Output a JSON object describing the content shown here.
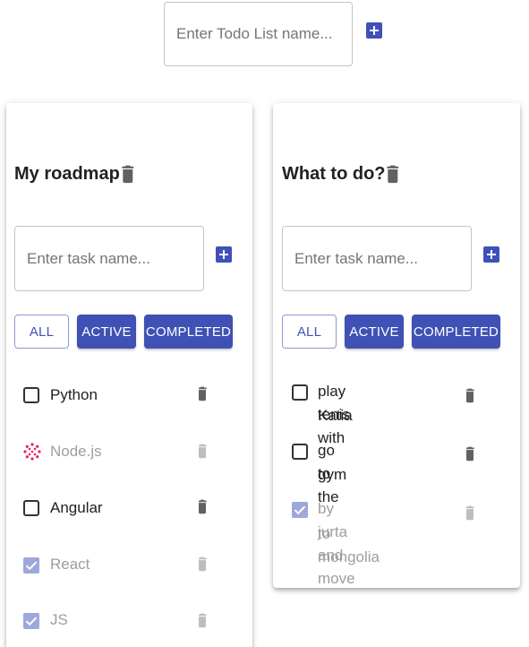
{
  "new_list": {
    "placeholder": "Enter Todo List name..."
  },
  "lists": [
    {
      "title": "My roadmap",
      "input_placeholder": "Enter task name...",
      "filters": [
        "ALL",
        "ACTIVE",
        "COMPLETED"
      ],
      "tasks": [
        {
          "label": "Python",
          "completed": false
        },
        {
          "label": "Node.js",
          "completed": false,
          "loading": true
        },
        {
          "label": "Angular",
          "completed": false
        },
        {
          "label": "React",
          "completed": true
        },
        {
          "label": "JS",
          "completed": true
        }
      ]
    },
    {
      "title": "What to do?",
      "input_placeholder": "Enter task name...",
      "filters": [
        "ALL",
        "ACTIVE",
        "COMPLETED"
      ],
      "tasks": [
        {
          "label_lines": [
            "play tenis with",
            "Katia"
          ],
          "completed": false
        },
        {
          "label_lines": [
            "go to the",
            "gym"
          ],
          "completed": false
        },
        {
          "label_lines": [
            "by jurta and move",
            "to mongolia"
          ],
          "completed": true
        }
      ]
    }
  ],
  "icons": {
    "add": "plus-icon",
    "delete": "trash-icon",
    "unchecked": "checkbox-blank-icon",
    "checked": "checkbox-checked-icon",
    "loading": "spinner-icon"
  },
  "colors": {
    "primary": "#3f51b5",
    "trash_active": "#616161",
    "trash_disabled": "#bdbdbd",
    "checked_disabled": "#9fa8da",
    "spinner": "#e91e63"
  }
}
